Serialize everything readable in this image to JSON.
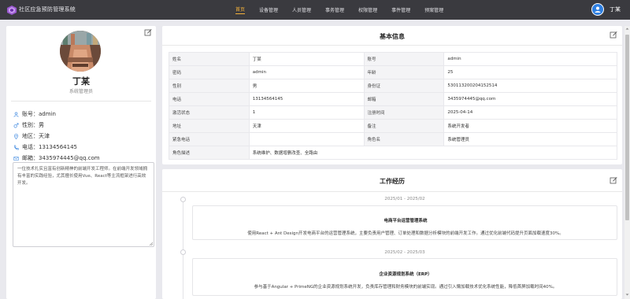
{
  "header": {
    "app_title": "社区应急预防管理系统",
    "nav": [
      {
        "label": "首页",
        "active": true
      },
      {
        "label": "设备管理",
        "active": false
      },
      {
        "label": "人员管理",
        "active": false
      },
      {
        "label": "事务管理",
        "active": false
      },
      {
        "label": "权限管理",
        "active": false
      },
      {
        "label": "事件管理",
        "active": false
      },
      {
        "label": "预案管理",
        "active": false
      }
    ],
    "user_name": "丁某",
    "accent_color": "#f5b23b",
    "avatar_color": "#2f7fe0",
    "user_icon": "user-avatar-icon"
  },
  "profile": {
    "name": "丁某",
    "role": "系统管理员",
    "account": "账号：admin",
    "gender": "性别：男",
    "region": "地区：天津",
    "phone": "电话：13134564145",
    "email": "邮箱：3435974445@qq.com",
    "bio": "一位技术扎实且富有创新精神的前端开发工程师。在前端开发领域拥有丰富的实践经验，尤其擅长使用Vue、React等主流框架进行高效开发。"
  },
  "basic_info": {
    "title": "基本信息",
    "rows": [
      [
        "姓名",
        "丁某",
        "账号",
        "admin"
      ],
      [
        "密码",
        "admin",
        "年龄",
        "25"
      ],
      [
        "性别",
        "男",
        "身份证",
        "530113200204152514"
      ],
      [
        "电话",
        "13134564145",
        "邮箱",
        "3435974445@qq.com"
      ],
      [
        "激活状态",
        "1",
        "注册时间",
        "2025-04-14"
      ],
      [
        "地址",
        "天津",
        "备注",
        "系统开发者"
      ],
      [
        "紧急电话",
        "",
        "角色名",
        "系统管理员"
      ],
      [
        "角色描述",
        "系统维护、数据增删改查、全路由",
        "",
        ""
      ]
    ]
  },
  "work_history": {
    "title": "工作经历",
    "items": [
      {
        "date": "2025/01 - 2025/02",
        "title": "电商平台运营管理系统",
        "desc": "使用React + Ant Design开发电商平台的运营管理系统，主要负责用户管理、订单处理和数据分析模块的前端开发工作。通过优化前端代码提升页面加载速度30%。"
      },
      {
        "date": "2025/02 - 2025/03",
        "title": "企业资源规划系统（ERP）",
        "desc": "参与基于Angular + PrimeNG的企业资源规划系统开发，负责库存管理和财务模块的前端实现。通过引入懒加载技术优化系统性能，降低首屏加载时间40%。"
      }
    ]
  }
}
